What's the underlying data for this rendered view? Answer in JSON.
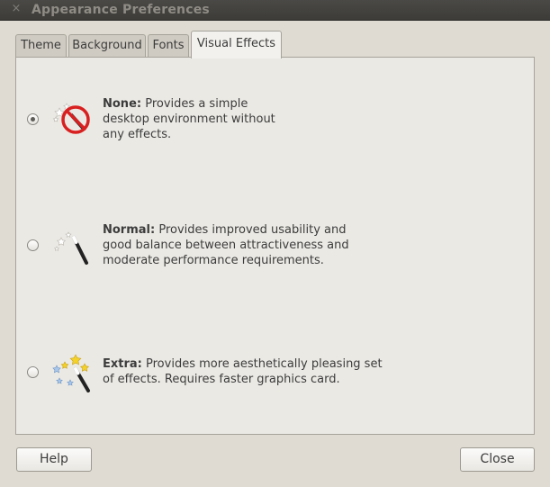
{
  "window": {
    "title": "Appearance Preferences",
    "close_glyph": "×"
  },
  "tabs": [
    {
      "label": "Theme"
    },
    {
      "label": "Background"
    },
    {
      "label": "Fonts"
    },
    {
      "label": "Visual Effects",
      "active": true
    }
  ],
  "effects": [
    {
      "name": "None:",
      "description_lines": [
        "Provides a simple",
        "desktop environment without",
        "any effects."
      ],
      "selected": true,
      "icon": "no-effects-icon"
    },
    {
      "name": "Normal:",
      "description_lines": [
        "Provides improved usability and",
        "good balance between attractiveness and",
        "moderate performance requirements."
      ],
      "selected": false,
      "icon": "magic-wand-icon"
    },
    {
      "name": "Extra:",
      "description_lines": [
        "Provides more aesthetically pleasing set",
        "of effects. Requires faster graphics card."
      ],
      "selected": false,
      "icon": "sparkle-wand-icon"
    }
  ],
  "buttons": {
    "help": "Help",
    "close": "Close"
  }
}
